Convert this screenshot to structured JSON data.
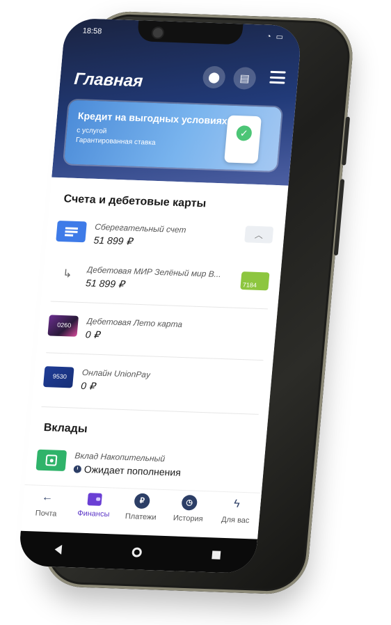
{
  "status_bar": {
    "time": "18:58"
  },
  "header": {
    "title": "Главная",
    "location_icon": "map-pin-icon",
    "chat_icon": "chat-icon",
    "menu_icon": "hamburger-menu-icon"
  },
  "promo": {
    "title": "Кредит на выгодных условиях",
    "line1": "с услугой",
    "line2": "Гарантированная ставка"
  },
  "accounts": {
    "section_title": "Счета и дебетовые карты",
    "items": [
      {
        "name": "Сберегательный счет",
        "amount": "51 899 ₽"
      },
      {
        "name": "Дебетовая МИР Зелёный мир В...",
        "amount": "51 899 ₽",
        "card_last4": "7184",
        "card_color": "#8dc63f"
      },
      {
        "name": "Дебетовая Лето карта",
        "amount": "0 ₽",
        "card_last4": "0260"
      },
      {
        "name": "Онлайн UnionPay",
        "amount": "0 ₽",
        "card_last4": "9530"
      }
    ]
  },
  "deposits": {
    "section_title": "Вклады",
    "items": [
      {
        "name": "Вклад Накопительный",
        "status": "Ожидает пополнения"
      }
    ]
  },
  "bottom_nav": {
    "items": [
      {
        "label": "Почта",
        "icon": "arrow-left-icon"
      },
      {
        "label": "Финансы",
        "icon": "wallet-icon",
        "active": true
      },
      {
        "label": "Платежи",
        "icon": "ruble-icon"
      },
      {
        "label": "История",
        "icon": "clock-icon"
      },
      {
        "label": "Для вас",
        "icon": "lightning-icon"
      }
    ]
  },
  "colors": {
    "header_bg": "#213a78",
    "accent": "#5b35c7",
    "savings_icon": "#3e7be8",
    "deposit_icon": "#2fb36a"
  }
}
